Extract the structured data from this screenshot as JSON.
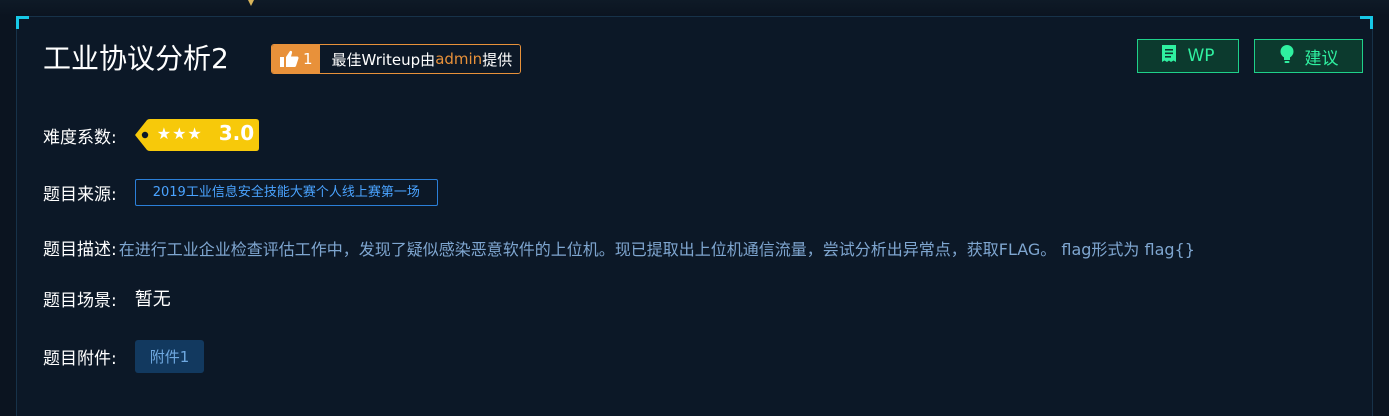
{
  "challenge": {
    "title": "工业协议分析2",
    "like_count": "1",
    "best_writeup_prefix": "最佳Writeup由",
    "best_writeup_user": "admin",
    "best_writeup_suffix": "提供"
  },
  "actions": {
    "wp_label": "WP",
    "suggest_label": "建议"
  },
  "difficulty": {
    "label": "难度系数:",
    "stars": "★★★",
    "value": "3.0"
  },
  "source": {
    "label": "题目来源:",
    "value": "2019工业信息安全技能大赛个人线上赛第一场"
  },
  "description": {
    "label": "题目描述:",
    "value": "在进行工业企业检查评估工作中，发现了疑似感染恶意软件的上位机。现已提取出上位机通信流量，尝试分析出异常点，获取FLAG。 flag形式为 flag{}"
  },
  "scene": {
    "label": "题目场景:",
    "value": "暂无"
  },
  "attachment": {
    "label": "题目附件:",
    "file_label": "附件1"
  },
  "colors": {
    "accent_orange": "#e8913a",
    "accent_green": "#1fd08a",
    "badge_yellow": "#f7c90a",
    "link_blue": "#4aa3ff"
  }
}
